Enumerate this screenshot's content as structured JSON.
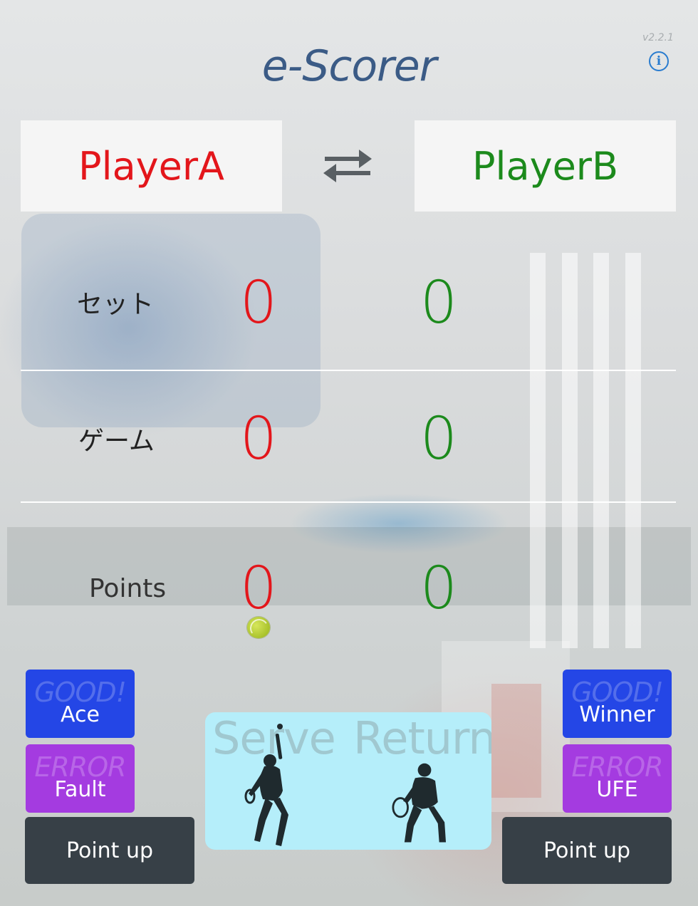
{
  "app": {
    "title": "e-Scorer",
    "version": "v2.2.1",
    "info_icon": "info-icon"
  },
  "players": {
    "a": {
      "name": "PlayerA",
      "color": "#e3161b"
    },
    "b": {
      "name": "PlayerB",
      "color": "#1c8a1c"
    },
    "swap_icon": "swap-arrows-icon"
  },
  "rows": {
    "sets": {
      "label": "セット",
      "a": "0",
      "b": "0"
    },
    "games": {
      "label": "ゲーム",
      "a": "0",
      "b": "0"
    },
    "points": {
      "label": "Points",
      "a": "0",
      "b": "0"
    }
  },
  "server_indicator": "tennis-ball-icon",
  "buttons": {
    "left": {
      "good_ghost": "GOOD!",
      "good_label": "Ace",
      "error_ghost": "ERROR",
      "error_label": "Fault",
      "point_up": "Point up"
    },
    "right": {
      "good_ghost": "GOOD!",
      "good_label": "Winner",
      "error_ghost": "ERROR",
      "error_label": "UFE",
      "point_up": "Point up"
    },
    "colors": {
      "good": "#2446e6",
      "error": "#a43be0",
      "point_up": "#374047"
    }
  },
  "serve_panel": {
    "serve_text": "Serve",
    "return_text": "Return",
    "background": "#b5eefa"
  }
}
